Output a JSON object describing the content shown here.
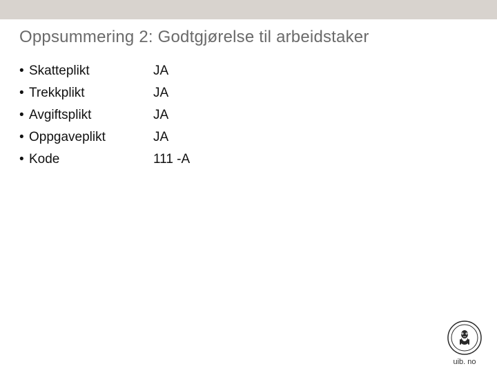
{
  "title": "Oppsummering 2: Godtgjørelse til arbeidstaker",
  "items": [
    {
      "label": "Skatteplikt",
      "value": "JA"
    },
    {
      "label": "Trekkplikt",
      "value": "JA"
    },
    {
      "label": "Avgiftsplikt",
      "value": "JA"
    },
    {
      "label": "Oppgaveplikt",
      "value": "JA"
    },
    {
      "label": "Kode",
      "value": "111 -A"
    }
  ],
  "footer": {
    "text": "uib. no",
    "logo_alt": "University of Bergen seal"
  },
  "bullet": "•"
}
